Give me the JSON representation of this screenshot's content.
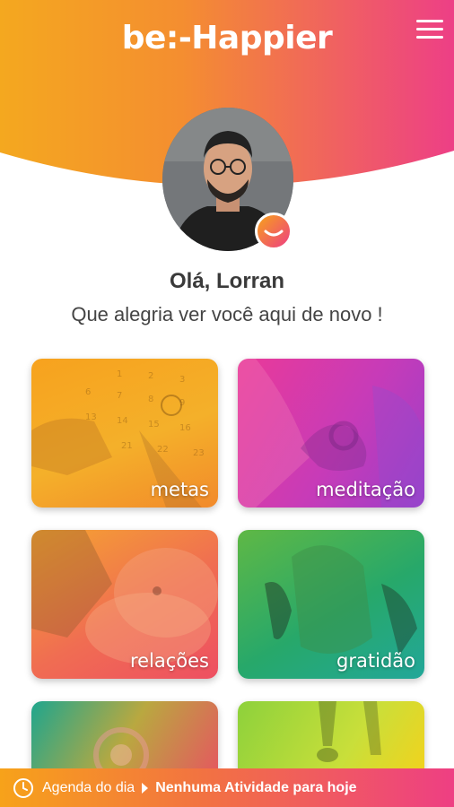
{
  "header": {
    "brand": "be:-Happier",
    "menu_icon": "hamburger-menu-icon"
  },
  "profile": {
    "greeting": "Olá, Lorran",
    "subtitle": "Que alegria ver você aqui de novo !",
    "badge_icon": "smile-icon"
  },
  "categories": [
    {
      "label": "metas"
    },
    {
      "label": "meditação"
    },
    {
      "label": "relações"
    },
    {
      "label": "gratidão"
    },
    {
      "label": ""
    },
    {
      "label": ""
    }
  ],
  "agenda": {
    "label": "Agenda do dia",
    "status": "Nenhuma Atividade para hoje",
    "icon": "clock-icon"
  },
  "colors": {
    "accent_orange": "#f7a21a",
    "accent_pink": "#ee3f83"
  }
}
